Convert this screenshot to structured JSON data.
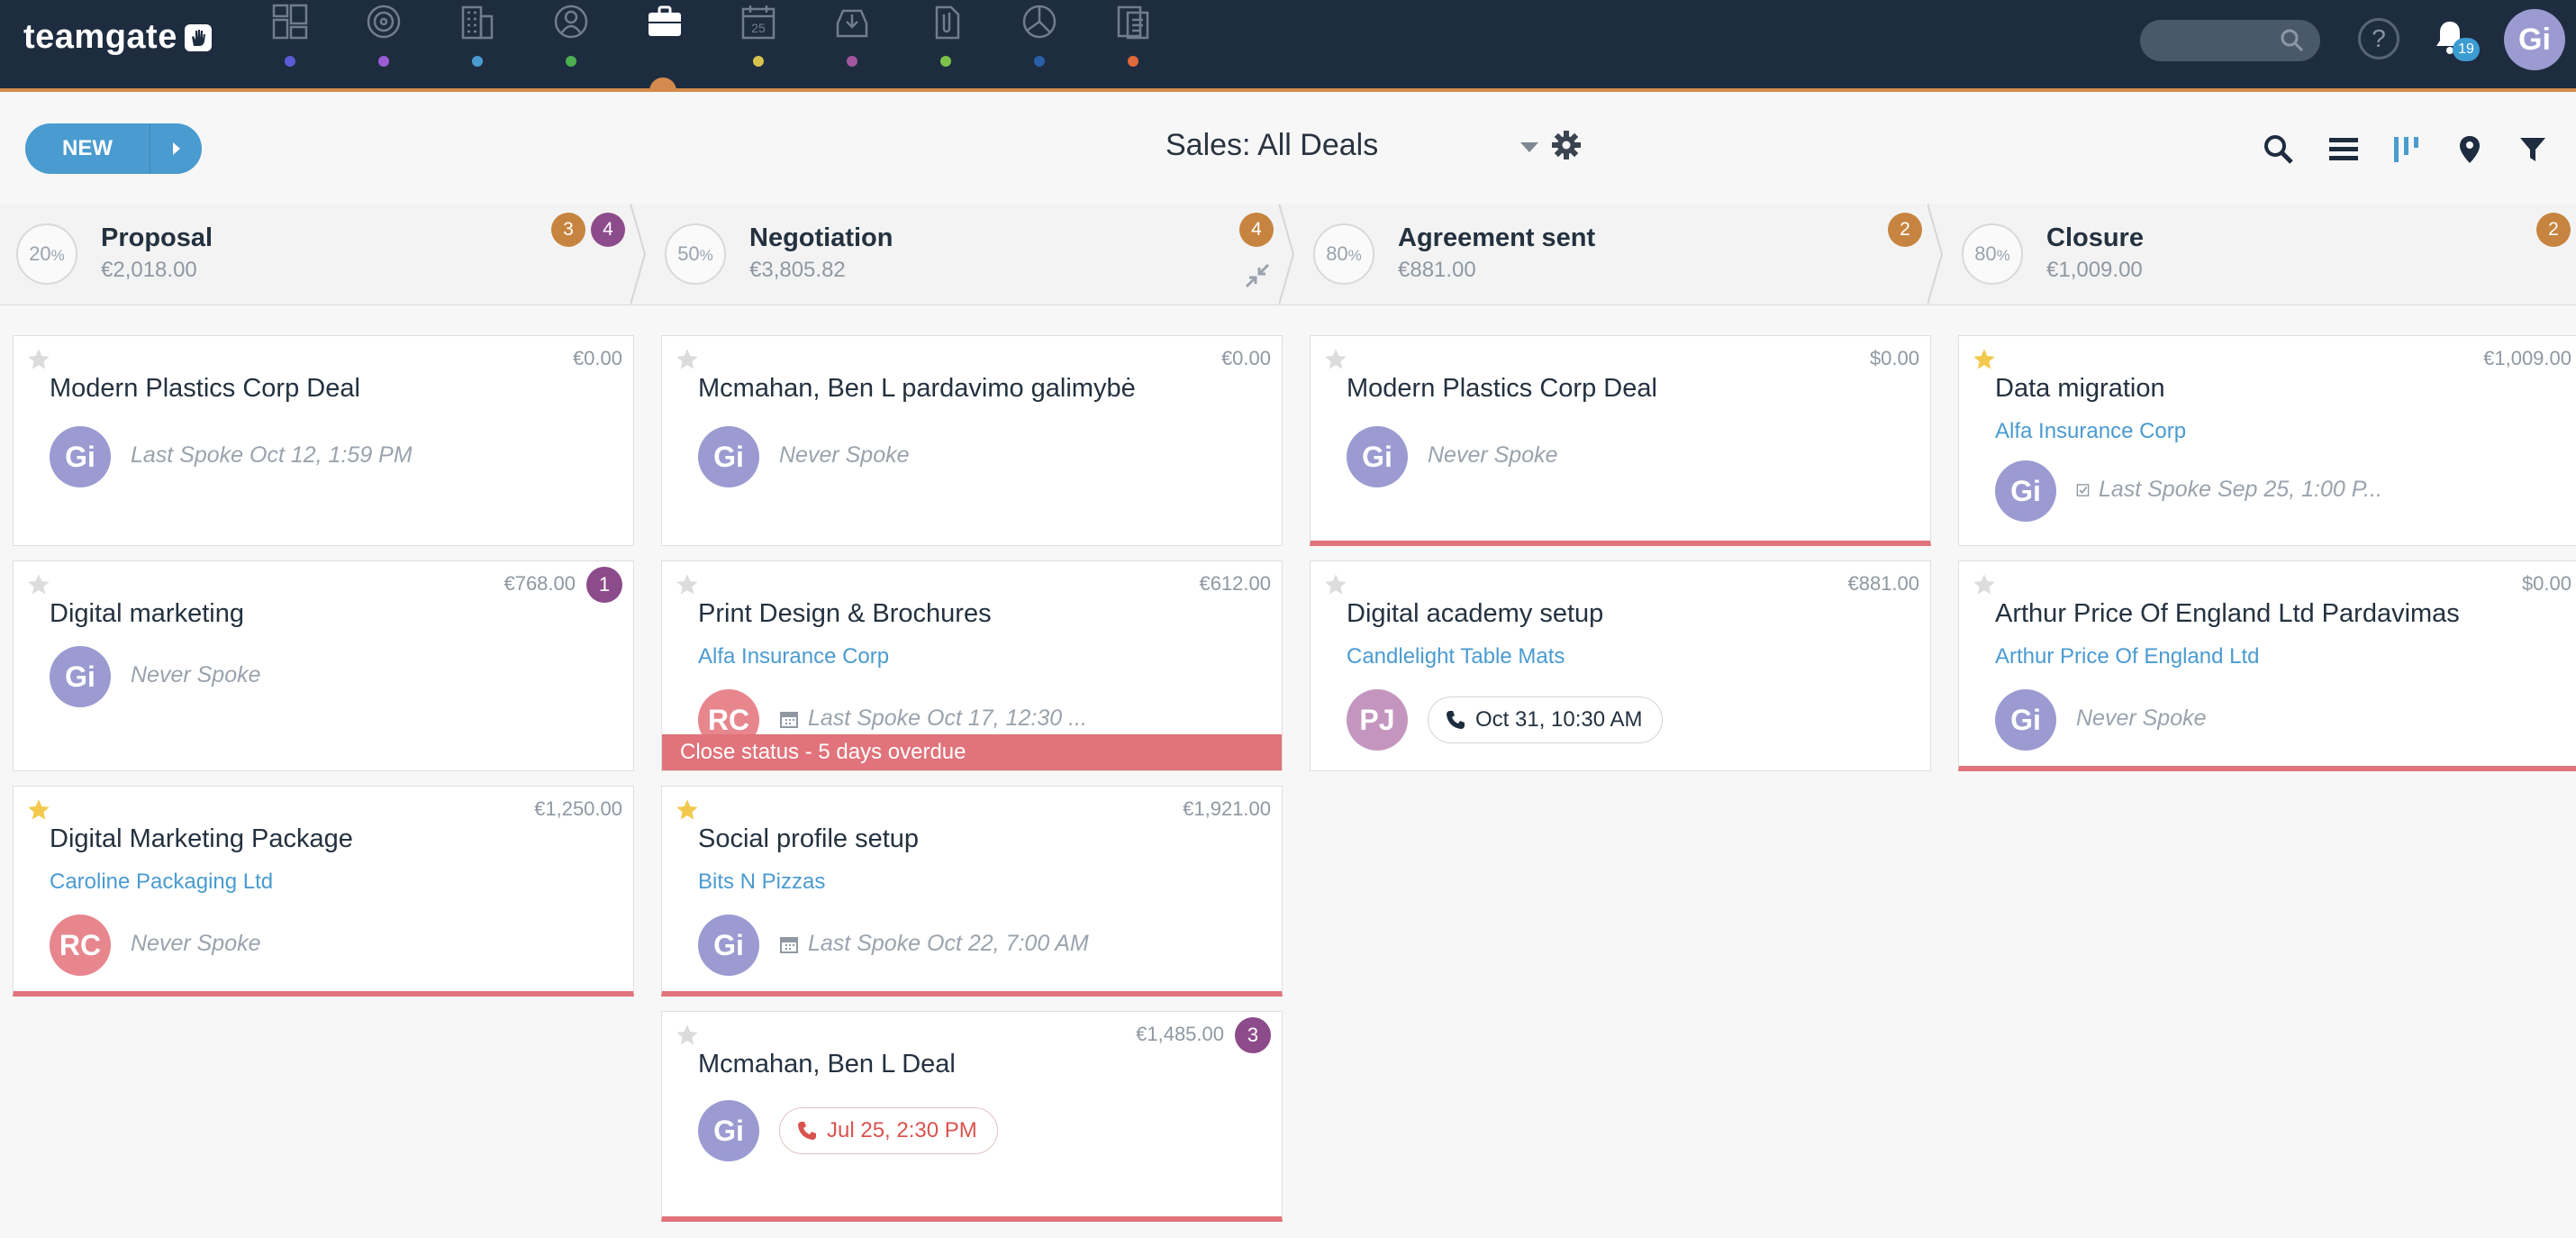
{
  "app": {
    "logo_text": "teamgate"
  },
  "topnav": {
    "items": [
      {
        "name": "dashboard-icon",
        "dot_color": "#5b5bd6"
      },
      {
        "name": "target-icon",
        "dot_color": "#9b5bd6"
      },
      {
        "name": "buildings-icon",
        "dot_color": "#4a9bd0"
      },
      {
        "name": "person-icon",
        "dot_color": "#4caf50"
      },
      {
        "name": "briefcase-icon",
        "dot_color": null
      },
      {
        "name": "calendar-icon",
        "dot_color": "#d4c24a"
      },
      {
        "name": "inbox-icon",
        "dot_color": "#a0579e"
      },
      {
        "name": "attachment-icon",
        "dot_color": "#7cc24a"
      },
      {
        "name": "chart-pie-icon",
        "dot_color": "#2a5fa8"
      },
      {
        "name": "reports-icon",
        "dot_color": "#e06a3a"
      }
    ],
    "notifications_count": "19",
    "user_initials": "Gi",
    "accent": "#d48a4c",
    "help_label": "?"
  },
  "toolbar": {
    "new_label": "NEW",
    "view_title": "Sales: All Deals"
  },
  "stages": [
    {
      "pct": "20",
      "pct_unit": "%",
      "name": "Proposal",
      "total": "€2,018.00",
      "badges": [
        {
          "value": "3",
          "color": "orange"
        },
        {
          "value": "4",
          "color": "purple"
        }
      ]
    },
    {
      "pct": "50",
      "pct_unit": "%",
      "name": "Negotiation",
      "total": "€3,805.82",
      "badges": [
        {
          "value": "4",
          "color": "orange"
        }
      ]
    },
    {
      "pct": "80",
      "pct_unit": "%",
      "name": "Agreement sent",
      "total": "€881.00",
      "badges": [
        {
          "value": "2",
          "color": "orange"
        }
      ]
    },
    {
      "pct": "80",
      "pct_unit": "%",
      "name": "Closure",
      "total": "€1,009.00",
      "badges": [
        {
          "value": "2",
          "color": "orange"
        }
      ]
    }
  ],
  "columns": [
    [
      {
        "starred": false,
        "amount": "€0.00",
        "title": "Modern Plastics Corp Deal",
        "company": null,
        "avatar": "Gi",
        "spoke": "Last Spoke Oct 12, 1:59 PM"
      },
      {
        "starred": false,
        "amount": "€768.00",
        "badge": "1",
        "title": "Digital marketing",
        "company": null,
        "avatar": "Gi",
        "spoke": "Never Spoke"
      },
      {
        "starred": true,
        "amount": "€1,250.00",
        "title": "Digital Marketing Package",
        "company": "Caroline Packaging Ltd",
        "avatar": "RC",
        "spoke": "Never Spoke"
      }
    ],
    [
      {
        "starred": false,
        "amount": "€0.00",
        "title": "Mcmahan, Ben L pardavimo galimybė",
        "company": null,
        "avatar": "Gi",
        "spoke": "Never Spoke"
      },
      {
        "starred": false,
        "amount": "€612.00",
        "title": "Print Design & Brochures",
        "company": "Alfa Insurance Corp",
        "avatar": "RC",
        "spoke": "Last Spoke Oct 17, 12:30 ...",
        "overdue": "Close status - 5 days overdue"
      },
      {
        "starred": true,
        "amount": "€1,921.00",
        "title": "Social profile setup",
        "company": "Bits N Pizzas",
        "avatar": "Gi",
        "spoke": "Last Spoke Oct 22, 7:00 AM"
      },
      {
        "starred": false,
        "amount": "€1,485.00",
        "badge": "3",
        "title": "Mcmahan, Ben L Deal",
        "company": null,
        "avatar": "Gi",
        "pill": "Jul 25, 2:30 PM"
      }
    ],
    [
      {
        "starred": false,
        "amount": "$0.00",
        "title": "Modern Plastics Corp Deal",
        "company": null,
        "avatar": "Gi",
        "spoke": "Never Spoke"
      },
      {
        "starred": false,
        "amount": "€881.00",
        "title": "Digital academy setup",
        "company": "Candlelight Table Mats",
        "avatar": "PJ",
        "pill": "Oct 31, 10:30 AM"
      }
    ],
    [
      {
        "starred": true,
        "amount": "€1,009.00",
        "title": "Data migration",
        "company": "Alfa Insurance Corp",
        "avatar": "Gi",
        "spoke": "Last Spoke Sep 25, 1:00 P..."
      },
      {
        "starred": false,
        "amount": "$0.00",
        "title": "Arthur Price Of England Ltd Pardavimas",
        "company": "Arthur Price Of England Ltd",
        "avatar": "Gi",
        "spoke": "Never Spoke"
      }
    ]
  ]
}
